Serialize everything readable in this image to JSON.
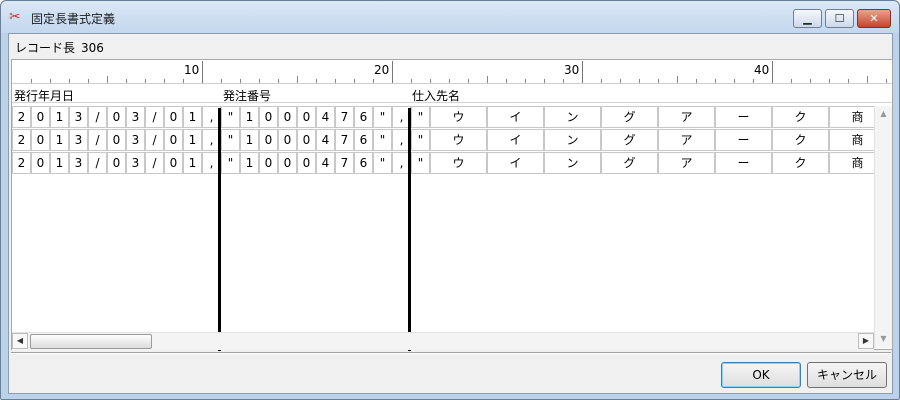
{
  "window": {
    "title": "固定長書式定義",
    "app_icon": "scissors-icon",
    "controls": {
      "minimize": "▁",
      "maximize": "☐",
      "close": "✕"
    }
  },
  "record": {
    "label": "レコード長",
    "value": "306"
  },
  "ruler": {
    "labels": [
      "10",
      "20",
      "30",
      "40"
    ]
  },
  "fields": [
    {
      "name": "発行年月日"
    },
    {
      "name": "発注番号"
    },
    {
      "name": "仕入先名"
    }
  ],
  "rows": [
    [
      "2",
      "0",
      "1",
      "3",
      "/",
      "0",
      "3",
      "/",
      "0",
      "1",
      ",",
      "\"",
      "1",
      "0",
      "0",
      "0",
      "4",
      "7",
      "6",
      "\"",
      ",",
      "\"",
      "ウ",
      "イ",
      "ン",
      "グ",
      "ア",
      "ー",
      "ク",
      "商"
    ],
    [
      "2",
      "0",
      "1",
      "3",
      "/",
      "0",
      "3",
      "/",
      "0",
      "1",
      ",",
      "\"",
      "1",
      "0",
      "0",
      "0",
      "4",
      "7",
      "6",
      "\"",
      ",",
      "\"",
      "ウ",
      "イ",
      "ン",
      "グ",
      "ア",
      "ー",
      "ク",
      "商"
    ],
    [
      "2",
      "0",
      "1",
      "3",
      "/",
      "0",
      "3",
      "/",
      "0",
      "1",
      ",",
      "\"",
      "1",
      "0",
      "0",
      "0",
      "4",
      "7",
      "6",
      "\"",
      ",",
      "\"",
      "ウ",
      "イ",
      "ン",
      "グ",
      "ア",
      "ー",
      "ク",
      "商"
    ]
  ],
  "buttons": {
    "ok": "OK",
    "cancel": "キャンセル"
  },
  "scrollbar": {
    "up": "▲",
    "down": "▼",
    "left": "◀",
    "right": "▶"
  }
}
